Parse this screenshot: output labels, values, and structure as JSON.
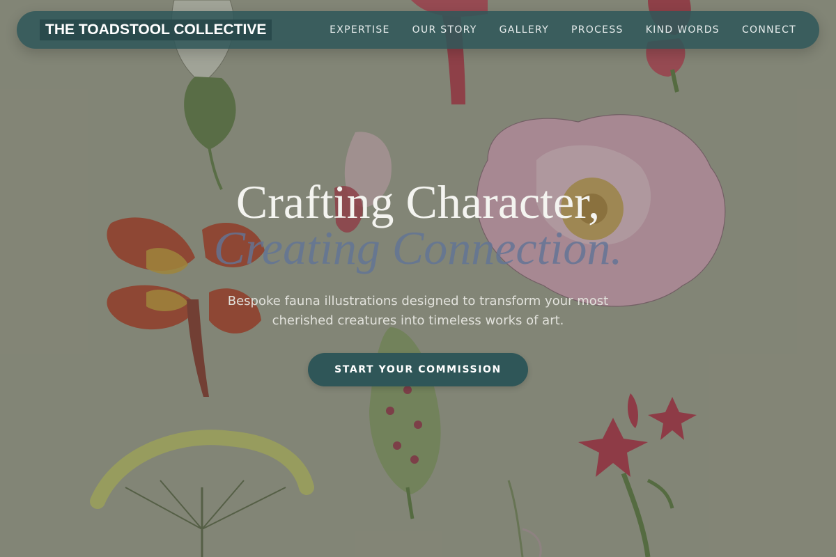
{
  "brand": {
    "name": "THE TOADSTOOL COLLECTIVE"
  },
  "nav": {
    "items": [
      {
        "label": "EXPERTISE"
      },
      {
        "label": "OUR STORY"
      },
      {
        "label": "GALLERY"
      },
      {
        "label": "PROCESS"
      },
      {
        "label": "KIND WORDS"
      },
      {
        "label": "CONNECT"
      }
    ]
  },
  "hero": {
    "headline_line1": "Crafting Character,",
    "headline_line2": "Creating Connection.",
    "subtitle": "Bespoke fauna illustrations designed to transform your most cherished creatures into timeless works of art.",
    "cta_label": "START YOUR COMMISSION"
  },
  "colors": {
    "navbar": "#2f5658",
    "accent_text": "#62749a",
    "background": "#86887a"
  }
}
